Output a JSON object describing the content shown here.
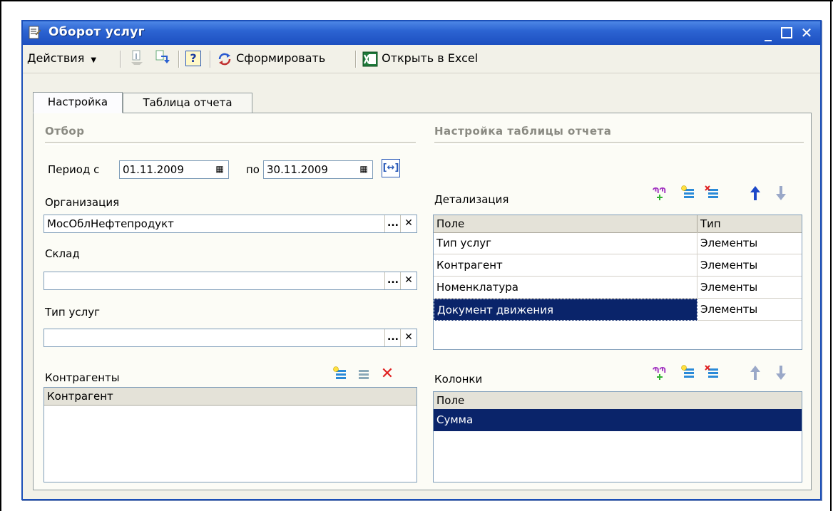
{
  "window": {
    "title": "Оборот услуг"
  },
  "toolbar": {
    "actions_label": "Действия",
    "form_label": "Сформировать",
    "excel_label": "Открыть в Excel",
    "help_label": "?"
  },
  "tabs": [
    "Настройка",
    "Таблица отчета"
  ],
  "filter": {
    "section_title": "Отбор",
    "period_label": "Период с",
    "period_from": "01.11.2009",
    "period_to_label": "по",
    "period_to": "30.11.2009",
    "org_label": "Организация",
    "org_value": "МосОблНефтепродукт",
    "warehouse_label": "Склад",
    "warehouse_value": "",
    "service_type_label": "Тип услуг",
    "service_type_value": "",
    "contractors_label": "Контрагенты",
    "contractors_header": "Контрагент"
  },
  "report_settings": {
    "section_title": "Настройка таблицы отчета",
    "detail_label": "Детализация",
    "detail_headers": [
      "Поле",
      "Тип"
    ],
    "detail_rows": [
      {
        "field": "Тип услуг",
        "type": "Элементы"
      },
      {
        "field": "Контрагент",
        "type": "Элементы"
      },
      {
        "field": "Номенклатура",
        "type": "Элементы"
      },
      {
        "field": "Документ движения",
        "type": "Элементы"
      }
    ],
    "columns_label": "Колонки",
    "columns_header": "Поле",
    "columns_rows": [
      "Сумма"
    ]
  },
  "colors": {
    "title_bar": "#2c64d2",
    "selection": "#0a246a",
    "delete_red": "#e02020",
    "arrow_blue": "#1c48c8"
  }
}
